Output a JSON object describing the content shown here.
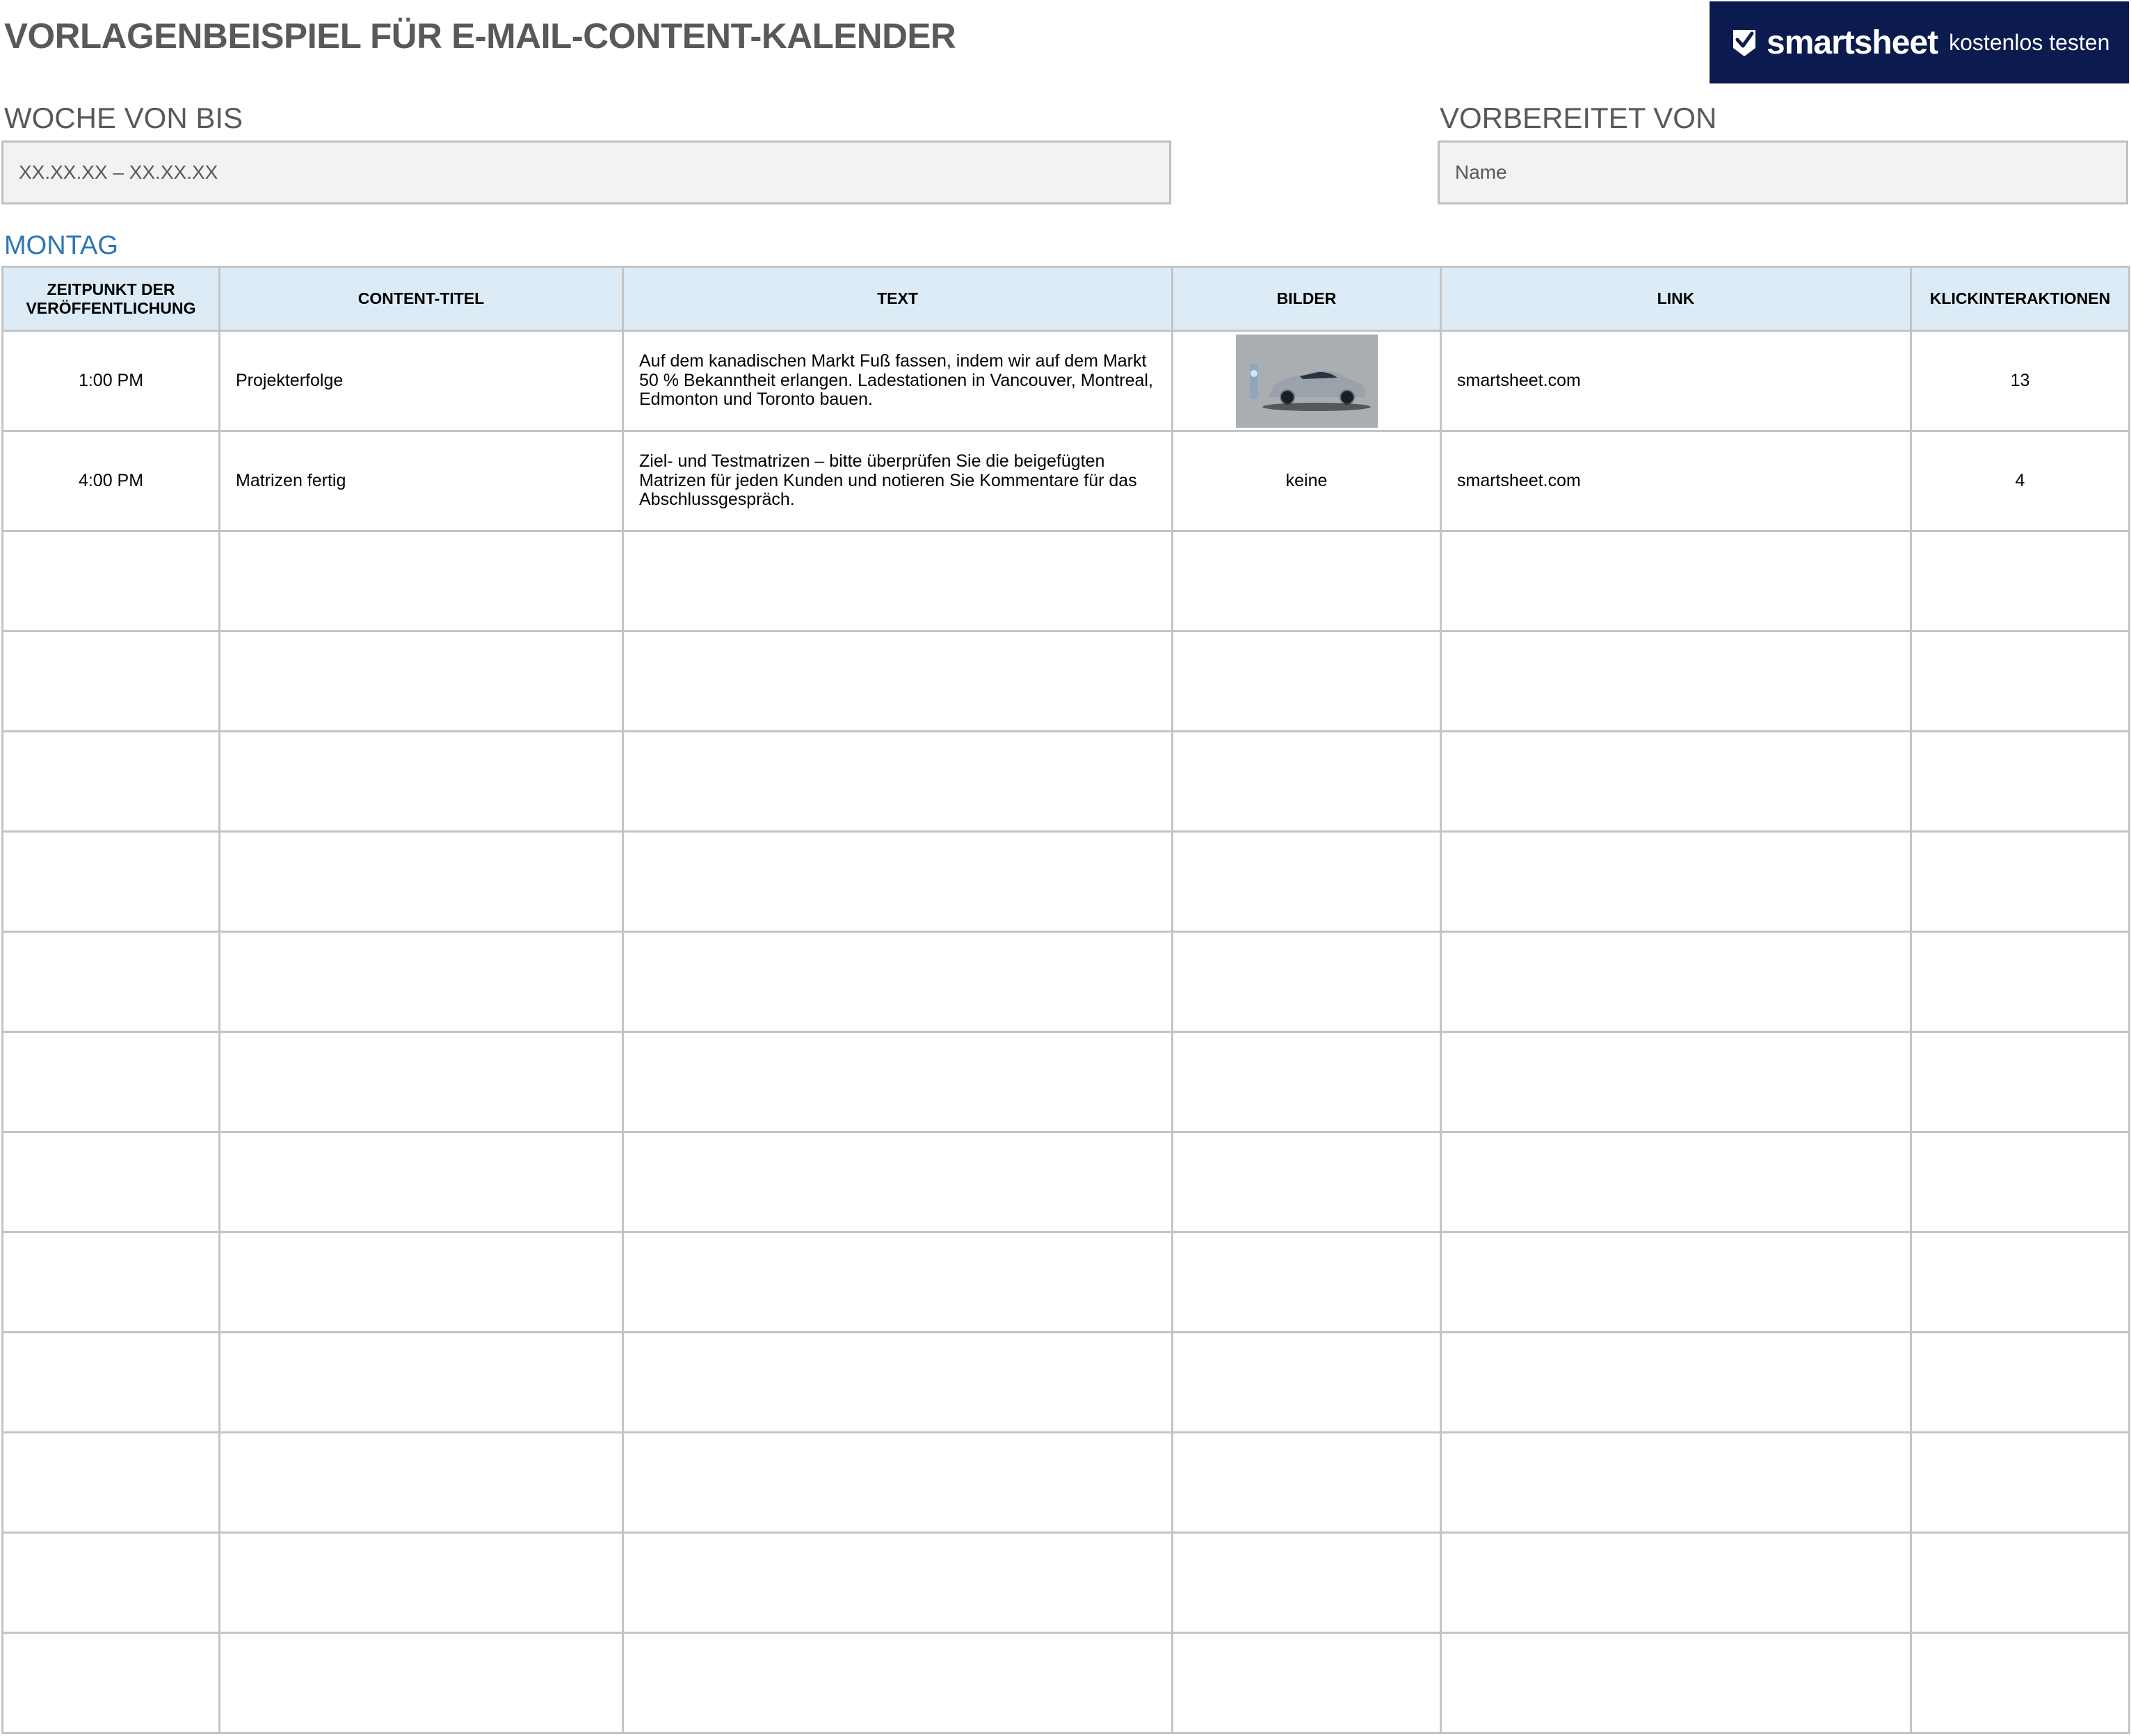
{
  "header": {
    "title": "VORLAGENBEISPIEL FÜR E-MAIL-CONTENT-KALENDER",
    "cta_brand": "smartsheet",
    "cta_label": "kostenlos testen"
  },
  "week": {
    "label": "WOCHE VON BIS",
    "value": "XX.XX.XX – XX.XX.XX"
  },
  "prepared": {
    "label": "VORBEREITET VON",
    "value": "Name"
  },
  "day": "MONTAG",
  "table": {
    "headers": {
      "time": "ZEITPUNKT DER VERÖFFENTLICHUNG",
      "title": "CONTENT-TITEL",
      "text": "TEXT",
      "images": "BILDER",
      "link": "LINK",
      "clicks": "KLICKINTERAKTIONEN"
    },
    "rows": [
      {
        "time": "1:00 PM",
        "title": "Projekterfolge",
        "text": "Auf dem kanadischen Markt Fuß fassen, indem wir auf dem Markt 50 % Bekanntheit erlangen. Ladestationen in Vancouver, Montreal, Edmonton und Toronto bauen.",
        "images": "",
        "link": "smartsheet.com",
        "clicks": "13"
      },
      {
        "time": "4:00 PM",
        "title": "Matrizen fertig",
        "text": "Ziel- und Testmatrizen – bitte überprüfen Sie die beigefügten Matrizen für jeden Kunden und notieren Sie Kommentare für das Abschlussgespräch.",
        "images": "keine",
        "link": "smartsheet.com",
        "clicks": "4"
      },
      {
        "time": "",
        "title": "",
        "text": "",
        "images": "",
        "link": "",
        "clicks": ""
      },
      {
        "time": "",
        "title": "",
        "text": "",
        "images": "",
        "link": "",
        "clicks": ""
      },
      {
        "time": "",
        "title": "",
        "text": "",
        "images": "",
        "link": "",
        "clicks": ""
      },
      {
        "time": "",
        "title": "",
        "text": "",
        "images": "",
        "link": "",
        "clicks": ""
      },
      {
        "time": "",
        "title": "",
        "text": "",
        "images": "",
        "link": "",
        "clicks": ""
      },
      {
        "time": "",
        "title": "",
        "text": "",
        "images": "",
        "link": "",
        "clicks": ""
      },
      {
        "time": "",
        "title": "",
        "text": "",
        "images": "",
        "link": "",
        "clicks": ""
      },
      {
        "time": "",
        "title": "",
        "text": "",
        "images": "",
        "link": "",
        "clicks": ""
      },
      {
        "time": "",
        "title": "",
        "text": "",
        "images": "",
        "link": "",
        "clicks": ""
      },
      {
        "time": "",
        "title": "",
        "text": "",
        "images": "",
        "link": "",
        "clicks": ""
      },
      {
        "time": "",
        "title": "",
        "text": "",
        "images": "",
        "link": "",
        "clicks": ""
      },
      {
        "time": "",
        "title": "",
        "text": "",
        "images": "",
        "link": "",
        "clicks": ""
      }
    ]
  },
  "icons": {
    "cta": "smartsheet-check-icon",
    "row_image": "car-photo-thumbnail"
  },
  "colors": {
    "title": "#595959",
    "day_label": "#2e75b6",
    "header_fill": "#ddebf7",
    "cta_background": "#0b1a4f",
    "field_fill": "#f2f2f2",
    "grid": "#c4c4c4"
  }
}
